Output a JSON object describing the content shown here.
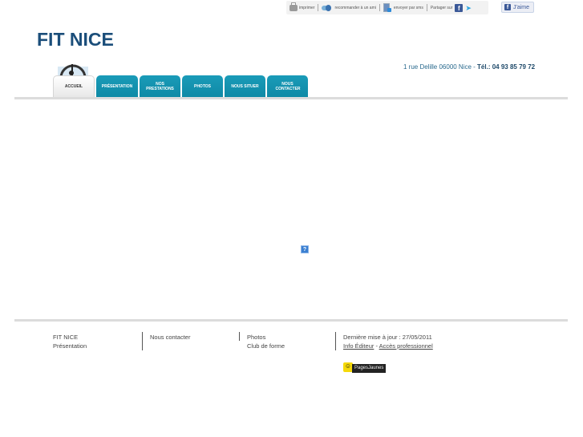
{
  "sharebar": {
    "print": "imprimer",
    "recommend": "recommander à un ami",
    "send": "envoyer par sms",
    "share_on": "Partager sur",
    "like": "J'aime"
  },
  "header": {
    "logo": "FIT NICE",
    "address": "1 rue Delille 06000 Nice",
    "address_sep": " - ",
    "tel": "Tél.: 04 93 85 79 72"
  },
  "nav": {
    "tabs": [
      {
        "label": "ACCUEIL",
        "active": true
      },
      {
        "label": "PRÉSENTATION"
      },
      {
        "label": "NOS PRESTATIONS"
      },
      {
        "label": "PHOTOS"
      },
      {
        "label": "NOUS SITUER"
      },
      {
        "label": "NOUS CONTACTER"
      }
    ]
  },
  "main": {
    "broken_image": "?"
  },
  "footer": {
    "col1": [
      "FIT NICE",
      "Présentation"
    ],
    "col2": [
      "Nous contacter"
    ],
    "col3": [
      "Photos",
      "Club de forme"
    ],
    "updated": "Dernière mise à jour : 27/05/2011",
    "info_editeur": "Info Éditeur",
    "link_sep": " - ",
    "acces_pro": "Accès professionnel",
    "pj_logo": "PagesJaunes",
    "pj_smile": "☺"
  }
}
